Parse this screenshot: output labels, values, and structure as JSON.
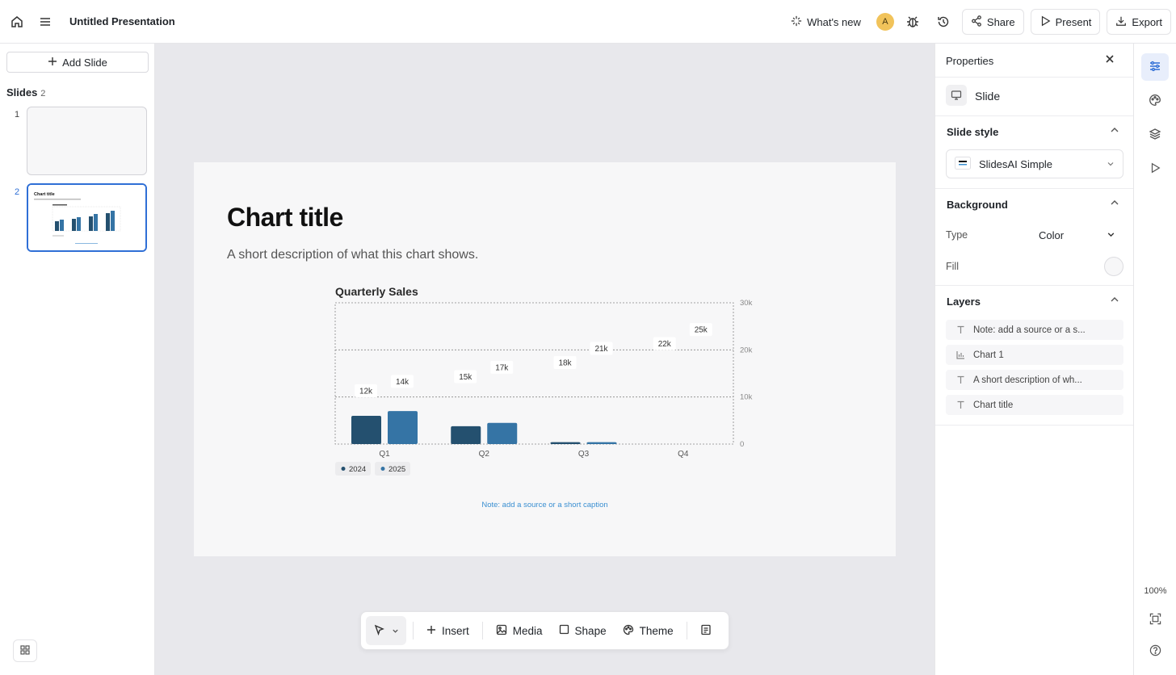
{
  "document": {
    "title": "Untitled Presentation"
  },
  "topbar": {
    "whats_new": "What's new",
    "avatar_initial": "A",
    "share": "Share",
    "present": "Present",
    "export": "Export"
  },
  "left_panel": {
    "add_slide": "Add Slide",
    "slides_label": "Slides",
    "slides_count": "2",
    "slides": [
      {
        "number": "1"
      },
      {
        "number": "2"
      }
    ]
  },
  "slide": {
    "title": "Chart title",
    "description": "A short description of what this chart shows.",
    "note": "Note: add a source or a short caption"
  },
  "chart_data": {
    "type": "bar",
    "title": "Quarterly Sales",
    "categories": [
      "Q1",
      "Q2",
      "Q3",
      "Q4"
    ],
    "series": [
      {
        "name": "2024",
        "values": [
          12000,
          15000,
          18000,
          22000
        ],
        "labels": [
          "12k",
          "15k",
          "18k",
          "22k"
        ],
        "bar_values": [
          6000,
          3800,
          400,
          0
        ],
        "color": "#24506f"
      },
      {
        "name": "2025",
        "values": [
          14000,
          17000,
          21000,
          25000
        ],
        "labels": [
          "14k",
          "17k",
          "21k",
          "25k"
        ],
        "bar_values": [
          7000,
          4500,
          400,
          0
        ],
        "color": "#3574a5"
      }
    ],
    "ylim": [
      0,
      30000
    ],
    "yticks": [
      "0",
      "10k",
      "20k",
      "30k"
    ],
    "ytick_values": [
      0,
      10000,
      20000,
      30000
    ],
    "grid": true,
    "legend": "bottom-left",
    "xlabel": "",
    "ylabel": ""
  },
  "toolbar": {
    "insert": "Insert",
    "media": "Media",
    "shape": "Shape",
    "theme": "Theme"
  },
  "properties": {
    "header": "Properties",
    "selection": "Slide",
    "slide_style": {
      "label": "Slide style",
      "value": "SlidesAI Simple"
    },
    "background": {
      "label": "Background",
      "type_label": "Type",
      "type_value": "Color",
      "fill_label": "Fill",
      "fill_color": "#f7f7f8"
    },
    "layers": {
      "label": "Layers",
      "items": [
        {
          "name": "Note: add a source or a s...",
          "icon": "text-icon"
        },
        {
          "name": "Chart 1",
          "icon": "chart-icon"
        },
        {
          "name": "A short description of wh...",
          "icon": "text-icon"
        },
        {
          "name": "Chart title",
          "icon": "text-icon"
        }
      ]
    }
  },
  "rail": {
    "zoom": "100%"
  },
  "colors": {
    "accent": "#2f6fd6",
    "canvas": "#e8e8ec",
    "note": "#3a8fd1"
  }
}
